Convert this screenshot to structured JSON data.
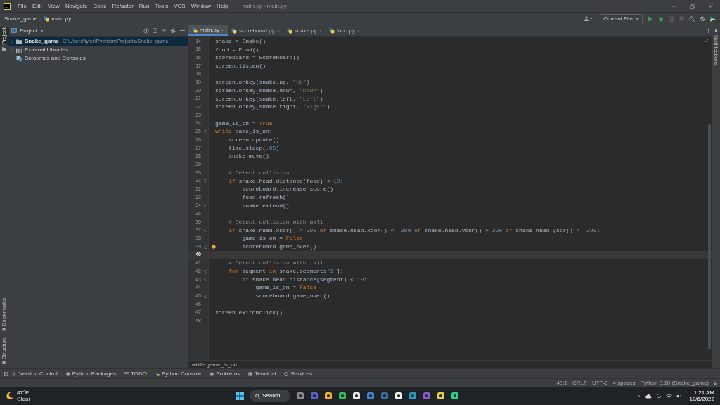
{
  "title_bar": {
    "menu": [
      "File",
      "Edit",
      "View",
      "Navigate",
      "Code",
      "Refactor",
      "Run",
      "Tools",
      "VCS",
      "Window",
      "Help"
    ],
    "title": "main.py - main.py"
  },
  "nav_bar": {
    "breadcrumbs": [
      "Snake_game",
      "main.py"
    ],
    "run_config": "Current File"
  },
  "left_strip": [
    {
      "label": "Project",
      "selected": true
    },
    {
      "label": "Bookmarks",
      "selected": false
    },
    {
      "label": "Structure",
      "selected": false
    }
  ],
  "right_strip": [
    "Notifications"
  ],
  "project_panel": {
    "title": "Project",
    "items": [
      {
        "kind": "folder",
        "label": "Snake_game",
        "path": "C:\\Users\\tyler\\PycharmProjects\\Snake_game",
        "expanded": false,
        "selected": true
      },
      {
        "kind": "library",
        "label": "External Libraries",
        "expanded": false,
        "selected": false
      },
      {
        "kind": "scratches",
        "label": "Scratches and Consoles",
        "selected": false
      }
    ]
  },
  "editor": {
    "tabs": [
      {
        "label": "main.py",
        "selected": true
      },
      {
        "label": "scoreboard.py",
        "selected": false
      },
      {
        "label": "snake.py",
        "selected": false
      },
      {
        "label": "food.py",
        "selected": false
      }
    ],
    "lines": [
      {
        "number": "14",
        "kind": "plain",
        "current": false,
        "segments": [
          {
            "kind": "plain",
            "text": "snake = Snake()"
          }
        ]
      },
      {
        "number": "15",
        "kind": "plain",
        "current": false,
        "segments": [
          {
            "kind": "plain",
            "text": "food = Food()"
          }
        ]
      },
      {
        "number": "16",
        "kind": "plain",
        "current": false,
        "segments": [
          {
            "kind": "plain",
            "text": "scoreboard = Scoreboard()"
          }
        ]
      },
      {
        "number": "17",
        "kind": "plain",
        "current": false,
        "segments": [
          {
            "kind": "plain",
            "text": "screen.listen()"
          }
        ]
      },
      {
        "number": "18",
        "kind": "plain",
        "current": false
      },
      {
        "number": "19",
        "kind": "plain",
        "current": false,
        "segments": [
          {
            "kind": "plain",
            "text": "screen.onkey(snake.up, "
          },
          {
            "kind": "string",
            "text": "\"Up\""
          },
          {
            "kind": "plain",
            "text": ")"
          }
        ]
      },
      {
        "number": "20",
        "kind": "plain",
        "current": false,
        "segments": [
          {
            "kind": "plain",
            "text": "screen.onkey(snake.down, "
          },
          {
            "kind": "string",
            "text": "\"Down\""
          },
          {
            "kind": "plain",
            "text": ")"
          }
        ]
      },
      {
        "number": "21",
        "kind": "plain",
        "current": false,
        "segments": [
          {
            "kind": "plain",
            "text": "screen.onkey(snake.left, "
          },
          {
            "kind": "string",
            "text": "\"Left\""
          },
          {
            "kind": "plain",
            "text": ")"
          }
        ]
      },
      {
        "number": "22",
        "kind": "plain",
        "current": false,
        "segments": [
          {
            "kind": "plain",
            "text": "screen.onkey(snake.right, "
          },
          {
            "kind": "string",
            "text": "\"Right\""
          },
          {
            "kind": "plain",
            "text": ")"
          }
        ]
      },
      {
        "number": "23",
        "kind": "plain",
        "current": false
      },
      {
        "number": "24",
        "kind": "plain",
        "current": false,
        "segments": [
          {
            "kind": "plain",
            "text": "game_is_on = "
          },
          {
            "kind": "keyword",
            "text": "True"
          }
        ]
      },
      {
        "number": "25",
        "kind": "fold-start",
        "current": false,
        "segments": [
          {
            "kind": "keyword",
            "text": "while "
          },
          {
            "kind": "plain",
            "text": "game_is_on:"
          }
        ]
      },
      {
        "number": "26",
        "kind": "plain",
        "current": false,
        "segments": [
          {
            "kind": "plain",
            "text": "    screen.update()"
          }
        ]
      },
      {
        "number": "27",
        "kind": "plain",
        "current": false,
        "segments": [
          {
            "kind": "plain",
            "text": "    time.sleep("
          },
          {
            "kind": "number",
            "text": ".05"
          },
          {
            "kind": "plain",
            "text": ")"
          }
        ]
      },
      {
        "number": "28",
        "kind": "plain",
        "current": false,
        "segments": [
          {
            "kind": "plain",
            "text": "    snake.move()"
          }
        ]
      },
      {
        "number": "29",
        "kind": "plain",
        "current": false
      },
      {
        "number": "30",
        "kind": "plain",
        "current": false,
        "segments": [
          {
            "kind": "comment",
            "text": "    # Detect collision"
          }
        ]
      },
      {
        "number": "31",
        "kind": "fold-start",
        "current": false,
        "segments": [
          {
            "kind": "keyword",
            "text": "    if "
          },
          {
            "kind": "plain",
            "text": "snake.head.distance(food) < "
          },
          {
            "kind": "number",
            "text": "10"
          },
          {
            "kind": "plain",
            "text": ":"
          }
        ]
      },
      {
        "number": "32",
        "kind": "plain",
        "current": false,
        "segments": [
          {
            "kind": "plain",
            "text": "        scoreboard.increase_score()"
          }
        ]
      },
      {
        "number": "33",
        "kind": "plain",
        "current": false,
        "segments": [
          {
            "kind": "plain",
            "text": "        food.refresh()"
          }
        ]
      },
      {
        "number": "34",
        "kind": "fold-end",
        "current": false,
        "segments": [
          {
            "kind": "plain",
            "text": "        snake.extend()"
          }
        ]
      },
      {
        "number": "35",
        "kind": "plain",
        "current": false
      },
      {
        "number": "36",
        "kind": "plain",
        "current": false,
        "segments": [
          {
            "kind": "comment",
            "text": "    # Detect collision with wall"
          }
        ]
      },
      {
        "number": "37",
        "kind": "fold-start",
        "current": false,
        "segments": [
          {
            "kind": "keyword",
            "text": "    if "
          },
          {
            "kind": "plain",
            "text": "snake.head.xcor() > "
          },
          {
            "kind": "number",
            "text": "290"
          },
          {
            "kind": "keyword",
            "text": " or "
          },
          {
            "kind": "plain",
            "text": "snake.head.xcor() < "
          },
          {
            "kind": "number",
            "text": "-290"
          },
          {
            "kind": "keyword",
            "text": " or "
          },
          {
            "kind": "plain",
            "text": "snake.head.ycor() > "
          },
          {
            "kind": "number",
            "text": "290"
          },
          {
            "kind": "keyword",
            "text": " or "
          },
          {
            "kind": "plain",
            "text": "snake.head.ycor() < "
          },
          {
            "kind": "number",
            "text": "-290"
          },
          {
            "kind": "plain",
            "text": ":"
          }
        ]
      },
      {
        "number": "38",
        "kind": "plain",
        "current": false,
        "segments": [
          {
            "kind": "plain",
            "text": "        game_is_on = "
          },
          {
            "kind": "keyword",
            "text": "False"
          }
        ]
      },
      {
        "number": "39",
        "kind": "fold-end",
        "current": false,
        "bulb": true,
        "segments": [
          {
            "kind": "plain",
            "text": "        scoreboard.game_over()"
          }
        ]
      },
      {
        "number": "40",
        "kind": "plain",
        "current": true
      },
      {
        "number": "41",
        "kind": "plain",
        "current": false,
        "segments": [
          {
            "kind": "comment",
            "text": "    # Detect collision with tail"
          }
        ]
      },
      {
        "number": "42",
        "kind": "fold-start",
        "current": false,
        "segments": [
          {
            "kind": "keyword",
            "text": "    for "
          },
          {
            "kind": "plain",
            "text": "segment "
          },
          {
            "kind": "keyword",
            "text": "in "
          },
          {
            "kind": "plain",
            "text": "snake.segments["
          },
          {
            "kind": "number",
            "text": "1"
          },
          {
            "kind": "plain",
            "text": ":]:"
          }
        ]
      },
      {
        "number": "43",
        "kind": "fold-start",
        "current": false,
        "segments": [
          {
            "kind": "keyword",
            "text": "        if "
          },
          {
            "kind": "plain",
            "text": "snake.head.distance(segment) < "
          },
          {
            "kind": "number",
            "text": "10"
          },
          {
            "kind": "plain",
            "text": ":"
          }
        ]
      },
      {
        "number": "44",
        "kind": "plain",
        "current": false,
        "segments": [
          {
            "kind": "plain",
            "text": "            game_is_on = "
          },
          {
            "kind": "keyword",
            "text": "False"
          }
        ]
      },
      {
        "number": "45",
        "kind": "fold-end",
        "current": false,
        "segments": [
          {
            "kind": "plain",
            "text": "            scoreboard.game_over()"
          }
        ]
      },
      {
        "number": "46",
        "kind": "plain",
        "current": false
      },
      {
        "number": "47",
        "kind": "plain",
        "current": false,
        "segments": [
          {
            "kind": "plain",
            "text": "screen.exitonclick()"
          }
        ]
      },
      {
        "number": "48",
        "kind": "plain",
        "current": false
      }
    ],
    "breadcrumb": "while game_is_on"
  },
  "tool_buttons": [
    {
      "kind": "vcs",
      "label": "Version Control"
    },
    {
      "kind": "packages",
      "label": "Python Packages"
    },
    {
      "kind": "todo",
      "label": "TODO"
    },
    {
      "kind": "console",
      "label": "Python Console"
    },
    {
      "kind": "problems",
      "label": "Problems"
    },
    {
      "kind": "terminal",
      "label": "Terminal"
    },
    {
      "kind": "services",
      "label": "Services"
    }
  ],
  "status_bar": [
    "40:1",
    "CRLF",
    "UTF-8",
    "4 spaces",
    "Python 3.10 (Snake_game)"
  ],
  "taskbar": {
    "weather": {
      "temperature": "47°F",
      "condition": "Clear"
    },
    "search": "Search",
    "time": "1:21 AM",
    "date": "12/6/2022",
    "apps": [
      {
        "color": "#8a8a8a"
      },
      {
        "color": "#5b5fc7"
      },
      {
        "color": "#f0b429"
      },
      {
        "color": "#2fbf5a"
      },
      {
        "color": "#e8e8e8"
      },
      {
        "color": "#3a86d6"
      },
      {
        "color": "#3a6ea5"
      },
      {
        "color": "#f4f4f4"
      },
      {
        "color": "#1fa0c9"
      },
      {
        "color": "#8a5cd1"
      },
      {
        "color": "#e6d430"
      },
      {
        "color": "#21d789"
      }
    ]
  }
}
